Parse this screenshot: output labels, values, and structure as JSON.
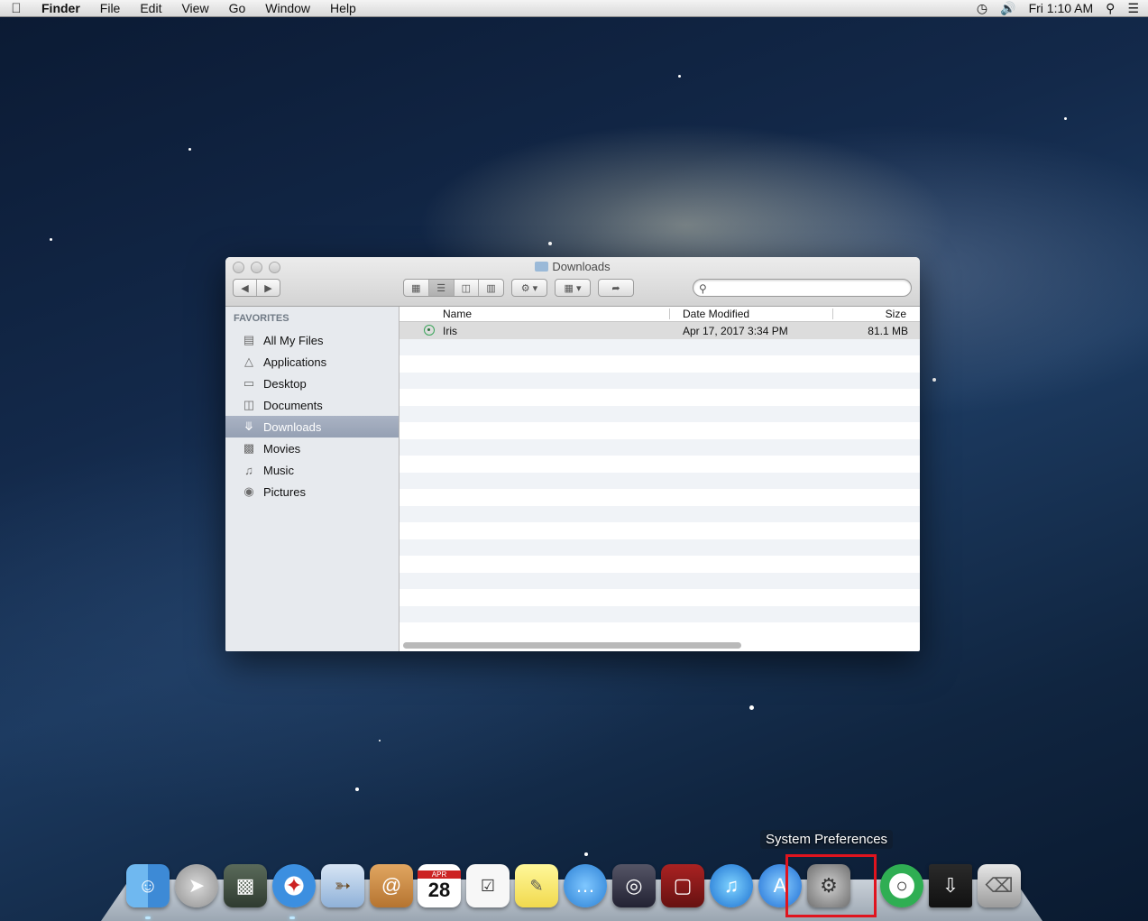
{
  "menubar": {
    "app_name": "Finder",
    "menus": [
      "File",
      "Edit",
      "View",
      "Go",
      "Window",
      "Help"
    ],
    "clock": "Fri 1:10 AM"
  },
  "window": {
    "title": "Downloads",
    "sidebar": {
      "heading": "FAVORITES",
      "items": [
        {
          "label": "All My Files",
          "icon": "all-files-icon"
        },
        {
          "label": "Applications",
          "icon": "applications-icon"
        },
        {
          "label": "Desktop",
          "icon": "desktop-icon"
        },
        {
          "label": "Documents",
          "icon": "documents-icon"
        },
        {
          "label": "Downloads",
          "icon": "downloads-icon",
          "selected": true
        },
        {
          "label": "Movies",
          "icon": "movies-icon"
        },
        {
          "label": "Music",
          "icon": "music-icon"
        },
        {
          "label": "Pictures",
          "icon": "pictures-icon"
        }
      ]
    },
    "columns": {
      "name": "Name",
      "date": "Date Modified",
      "size": "Size"
    },
    "files": [
      {
        "name": "Iris",
        "date": "Apr 17, 2017 3:34 PM",
        "size": "81.1 MB"
      }
    ]
  },
  "dock": {
    "tooltip": "System Preferences",
    "calendar_month": "APR",
    "calendar_day": "28",
    "items": [
      "finder-icon",
      "launchpad-icon",
      "image-capture-icon",
      "safari-icon",
      "mail-icon",
      "contacts-icon",
      "calendar-icon",
      "reminders-icon",
      "notes-icon",
      "messages-icon",
      "facetime-icon",
      "photo-booth-icon",
      "itunes-icon",
      "app-store-icon",
      "system-preferences-icon",
      "iris-app-icon",
      "downloads-stack-icon",
      "trash-icon"
    ]
  }
}
